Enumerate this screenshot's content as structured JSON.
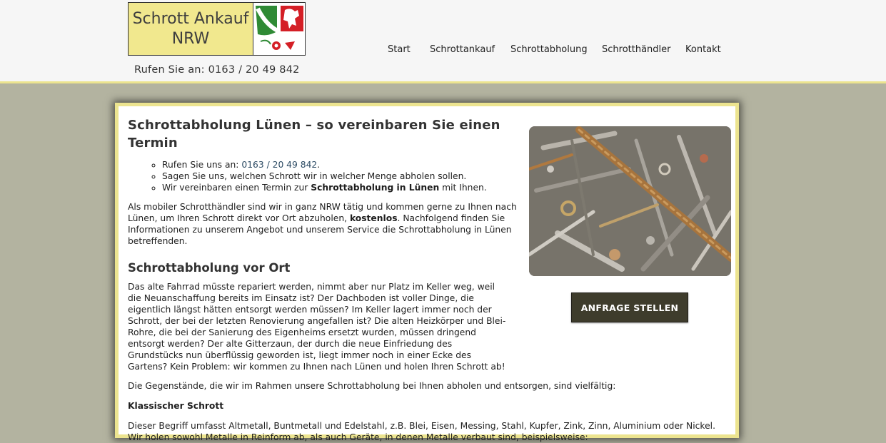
{
  "header": {
    "logo_line1": "Schrott Ankauf",
    "logo_line2": "NRW",
    "phone": "Rufen Sie an: 0163 / 20 49 842"
  },
  "nav": [
    {
      "label": "Start"
    },
    {
      "label": "Schrottankauf"
    },
    {
      "label": "Schrottabholung"
    },
    {
      "label": "Schrotthändler"
    },
    {
      "label": "Kontakt"
    }
  ],
  "main": {
    "title": "Schrottabholung Lünen – so vereinbaren Sie einen Termin",
    "steps": {
      "s1_prefix": "Rufen Sie uns an: ",
      "s1_phone": "0163 / 20 49 842",
      "s1_suffix": ".",
      "s2": "Sagen Sie uns, welchen Schrott wir in welcher Menge abholen sollen.",
      "s3_prefix": "Wir vereinbaren einen Termin zur ",
      "s3_bold": "Schrottabholung in Lünen",
      "s3_suffix": " mit Ihnen."
    },
    "intro_a": "Als mobiler Schrotthändler sind wir in ganz NRW tätig und kommen gerne zu Ihnen nach Lünen, um Ihren Schrott direkt vor Ort abzuholen, ",
    "intro_bold": "kostenlos",
    "intro_b": ". Nachfolgend finden Sie Informationen zu unserem Angebot und unserem Service die Schrottabholung in Lünen betreffenden.",
    "section_title": "Schrottabholung vor Ort",
    "para_vorort": "Das alte Fahrrad müsste repariert werden, nimmt aber nur Platz im Keller weg, weil die Neuanschaffung bereits im Einsatz ist? Der Dachboden ist voller Dinge, die eigentlich längst hätten entsorgt werden müssen? Im Keller lagert immer noch der Schrott, der bei der letzten Renovierung angefallen ist? Die alten Heizkörper und Blei-Rohre, die bei der Sanierung des Eigenheims ersetzt wurden, müssen dringend entsorgt werden? Der alte Gitterzaun, der durch die neue Einfriedung des Grundstücks nun überflüssig geworden ist, liegt immer noch in einer Ecke des Gartens? Kein Problem: wir kommen zu Ihnen nach Lünen und holen Ihren Schrott ab!",
    "para_items": "Die Gegenstände, die wir im Rahmen unsere Schrottabholung bei Ihnen abholen und entsorgen, sind vielfältig:",
    "subheading": "Klassischer Schrott",
    "para_classic": "Dieser Begriff umfasst Altmetall, Buntmetall und Edelstahl, z.B. Blei, Eisen, Messing, Stahl, Kupfer, Zink, Zinn, Aluminium oder Nickel. Wir holen sowohl Metalle in Reinform ab, als auch Geräte, in denen Metalle verbaut sind, beispielsweise:"
  },
  "cta_label": "ANFRAGE STELLEN",
  "colors": {
    "page_bg": "#b3b3a0",
    "accent_yellow": "#ece48f",
    "button_bg": "#3e3c2c",
    "link": "#2b4a63"
  }
}
